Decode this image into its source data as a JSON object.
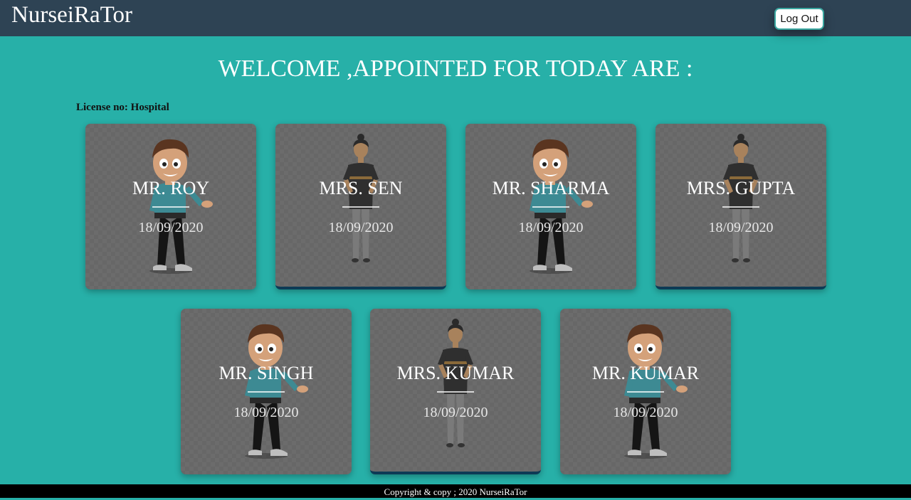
{
  "navbar": {
    "brand": "NurseiRaTor",
    "logout_label": "Log Out"
  },
  "main": {
    "welcome": "WELCOME ,APPOINTED FOR TODAY ARE :",
    "license": "License no: Hospital"
  },
  "appointments": [
    {
      "name": "MR. ROY",
      "date": "18/09/2020",
      "avatar": "male-avatar-icon"
    },
    {
      "name": "MRS. SEN",
      "date": "18/09/2020",
      "avatar": "female-avatar-icon"
    },
    {
      "name": "MR. SHARMA",
      "date": "18/09/2020",
      "avatar": "male-avatar-icon"
    },
    {
      "name": "MRS. GUPTA",
      "date": "18/09/2020",
      "avatar": "female-avatar-icon"
    },
    {
      "name": "MR. SINGH",
      "date": "18/09/2020",
      "avatar": "male-avatar-icon"
    },
    {
      "name": "MRS. KUMAR",
      "date": "18/09/2020",
      "avatar": "female-avatar-icon"
    },
    {
      "name": "MR. KUMAR",
      "date": "18/09/2020",
      "avatar": "male-avatar-icon"
    }
  ],
  "footer": {
    "copyright": "Copyright & copy ; 2020 NurseiRaTor"
  },
  "colors": {
    "navbar": "#2e4354",
    "background": "#27b0a8",
    "card": "#676767",
    "footer": "#000000"
  }
}
